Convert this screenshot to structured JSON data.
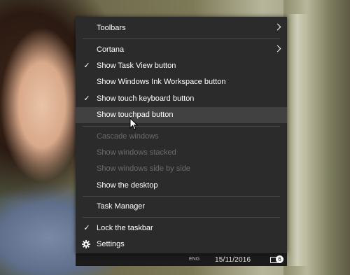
{
  "menu": {
    "items": [
      {
        "label": "Toolbars",
        "has_submenu": true
      },
      {
        "label": "Cortana",
        "has_submenu": true
      },
      {
        "label": "Show Task View button",
        "checked": true
      },
      {
        "label": "Show Windows Ink Workspace button",
        "checked": false
      },
      {
        "label": "Show touch keyboard button",
        "checked": true
      },
      {
        "label": "Show touchpad button",
        "checked": false,
        "hovered": true
      },
      {
        "label": "Cascade windows",
        "disabled": true
      },
      {
        "label": "Show windows stacked",
        "disabled": true
      },
      {
        "label": "Show windows side by side",
        "disabled": true
      },
      {
        "label": "Show the desktop"
      },
      {
        "label": "Task Manager"
      },
      {
        "label": "Lock the taskbar",
        "checked": true
      },
      {
        "label": "Settings",
        "icon": "gear-icon"
      }
    ],
    "check_glyph": "✓"
  },
  "taskbar": {
    "date": "15/11/2016",
    "language": "ENG",
    "notification_count": "6"
  },
  "colors": {
    "menu_bg": "#2b2b2b",
    "hover_bg": "#414141",
    "disabled_text": "#6b6b6b",
    "separator": "#4a4a4a"
  }
}
